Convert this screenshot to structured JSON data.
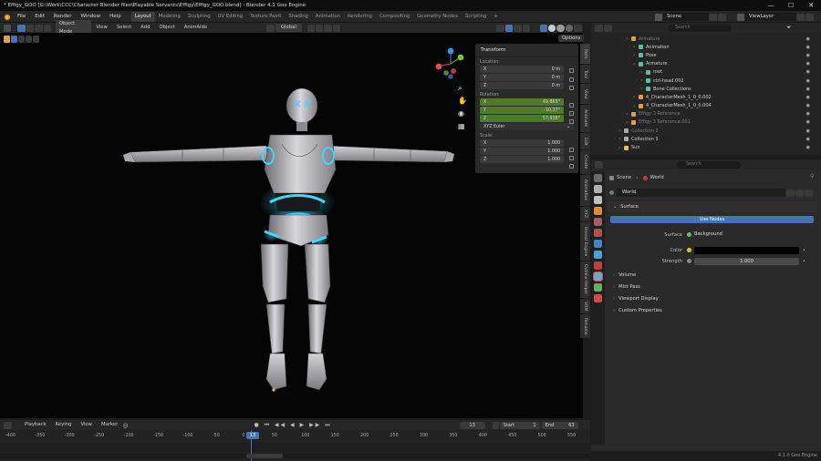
{
  "window": {
    "title": "* Effigy_GOO [G:\\Work\\CCC\\Character Blender files\\Playable Servants\\Effigy\\Effigy_GOO.blend] - Blender 4.1 Goo Engine",
    "controls": [
      "—",
      "☐",
      "✕"
    ]
  },
  "menubar": {
    "menus": [
      "File",
      "Edit",
      "Render",
      "Window",
      "Help"
    ],
    "workspaces": [
      "Layout",
      "Modeling",
      "Sculpting",
      "UV Editing",
      "Texture Paint",
      "Shading",
      "Animation",
      "Rendering",
      "Compositing",
      "Geometry Nodes",
      "Scripting"
    ],
    "active_workspace": "Layout",
    "add_tab": "+",
    "scene_label": "Scene",
    "view_layer_label": "ViewLayer"
  },
  "viewport_header": {
    "mode": "Object Mode",
    "menus": [
      "View",
      "Select",
      "Add",
      "Object",
      "AnimAide"
    ],
    "transform_orientation": "Global",
    "options_label": "Options"
  },
  "npanel": {
    "title": "Transform",
    "location_label": "Location:",
    "location": [
      {
        "axis": "X",
        "value": "0 m"
      },
      {
        "axis": "Y",
        "value": "0 m"
      },
      {
        "axis": "Z",
        "value": "0 m"
      }
    ],
    "rotation_label": "Rotation:",
    "rotation": [
      {
        "axis": "X",
        "value": "49.863°"
      },
      {
        "axis": "Y",
        "value": "-10.37°"
      },
      {
        "axis": "Z",
        "value": "57.938°"
      }
    ],
    "rotation_mode": "XYZ Euler",
    "scale_label": "Scale:",
    "scale": [
      {
        "axis": "X",
        "value": "1.000"
      },
      {
        "axis": "Y",
        "value": "1.000"
      },
      {
        "axis": "Z",
        "value": "1.000"
      }
    ]
  },
  "side_tabs": [
    "Item",
    "Tool",
    "View",
    "Animate",
    "Edit",
    "Create",
    "Animation",
    "XYZ",
    "Unreal Engine",
    "Outline Helper",
    "VRM",
    "Rename"
  ],
  "outliner": {
    "search_placeholder": "Search",
    "rows": [
      {
        "indent": 1,
        "label": "Armature",
        "color": "#e0a050",
        "dim": true
      },
      {
        "indent": 2,
        "label": "Animation",
        "color": "#57c1a5"
      },
      {
        "indent": 2,
        "label": "Pose",
        "color": "#57c1a5"
      },
      {
        "indent": 2,
        "label": "Armature",
        "color": "#57c1a5"
      },
      {
        "indent": 3,
        "label": "root",
        "color": "#57c1a5"
      },
      {
        "indent": 3,
        "label": "ctrl-head.002",
        "color": "#57c1a5"
      },
      {
        "indent": 3,
        "label": "Bone Collections",
        "color": "#57c1a5"
      },
      {
        "indent": 2,
        "label": "4_CharacterMesh_1_0_0.002",
        "color": "#e0a050"
      },
      {
        "indent": 2,
        "label": "4_CharacterMesh_1_0_0.004",
        "color": "#e0a050"
      },
      {
        "indent": 1,
        "label": "Effigy 3 Reference",
        "color": "#e0a050",
        "dim": true
      },
      {
        "indent": 1,
        "label": "Effigy 3 Reference.001",
        "color": "#e0a050",
        "dim": true
      },
      {
        "indent": 0,
        "label": "Collection 2",
        "color": "#aaaaaa",
        "dim": true
      },
      {
        "indent": 0,
        "label": "Collection 3",
        "color": "#aaaaaa"
      },
      {
        "indent": 0,
        "label": "Sun",
        "color": "#e0c060"
      }
    ]
  },
  "properties": {
    "search_placeholder": "Search",
    "breadcrumb_scene": "Scene",
    "breadcrumb_world": "World",
    "world_name": "World",
    "surface_section": "Surface",
    "use_nodes_label": "Use Nodes",
    "surface_label": "Surface",
    "surface_value": "Background",
    "color_label": "Color",
    "strength_label": "Strength",
    "strength_value": "1.000",
    "sections": [
      "Volume",
      "Mist Pass",
      "Viewport Display",
      "Custom Properties"
    ],
    "tab_colors": [
      "#6a6a6a",
      "#b0b0b0",
      "#c0c0c0",
      "#e08a40",
      "#a06060",
      "#b05050",
      "#4a80d0",
      "#50a0d0",
      "#c04040",
      "#60b0c0",
      "#60b060",
      "#d04a4a"
    ]
  },
  "timeline": {
    "menus": [
      "Playback",
      "Keying",
      "View",
      "Marker"
    ],
    "current_frame": "13",
    "start_label": "Start",
    "start_value": "1",
    "end_label": "End",
    "end_value": "63",
    "ticks": [
      "-400",
      "-350",
      "-300",
      "-250",
      "-200",
      "-150",
      "-100",
      "-50",
      "0",
      "50",
      "100",
      "150",
      "200",
      "250",
      "300",
      "350",
      "400",
      "450",
      "500",
      "550"
    ],
    "playhead_label": "13"
  },
  "status": {
    "version": "4.1.0 Goo Engine"
  },
  "colors": {
    "accent_blue": "#4772b3",
    "glow_cyan": "#3fd6ff",
    "x_axis": "#e74c5a",
    "y_axis": "#7bc142",
    "z_axis": "#3d8fe8"
  }
}
